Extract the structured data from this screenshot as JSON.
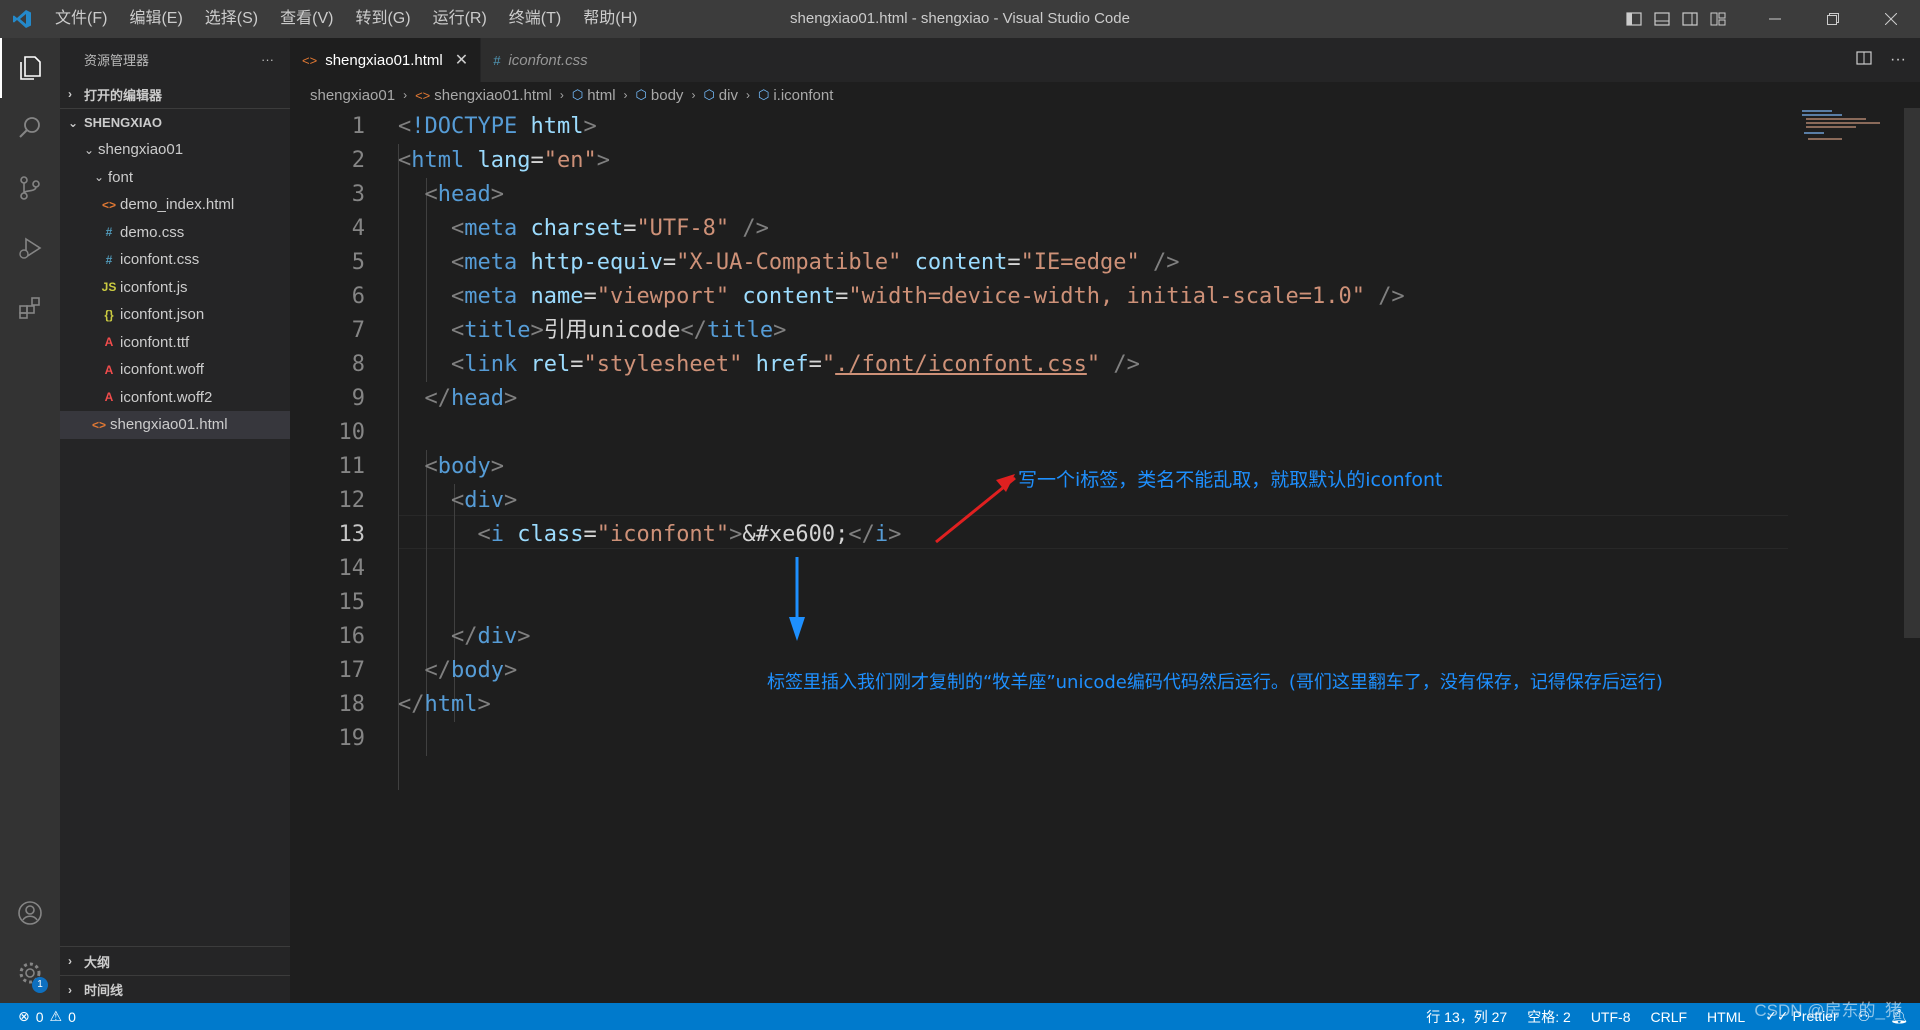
{
  "titlebar": {
    "menu": [
      "文件(F)",
      "编辑(E)",
      "选择(S)",
      "查看(V)",
      "转到(G)",
      "运行(R)",
      "终端(T)",
      "帮助(H)"
    ],
    "title": "shengxiao01.html - shengxiao - Visual Studio Code"
  },
  "sidebar": {
    "header": "资源管理器",
    "more": "···",
    "open_editors": "打开的编辑器",
    "workspace": "SHENGXIAO",
    "folder": "shengxiao01",
    "subfolder": "font",
    "files": [
      {
        "icon": "<>",
        "name": "demo_index.html",
        "color": "#e37933"
      },
      {
        "icon": "#",
        "name": "demo.css",
        "color": "#519aba"
      },
      {
        "icon": "#",
        "name": "iconfont.css",
        "color": "#519aba"
      },
      {
        "icon": "JS",
        "name": "iconfont.js",
        "color": "#cbcb41"
      },
      {
        "icon": "{}",
        "name": "iconfont.json",
        "color": "#cbcb41"
      },
      {
        "icon": "A",
        "name": "iconfont.ttf",
        "color": "#f14c4c"
      },
      {
        "icon": "A",
        "name": "iconfont.woff",
        "color": "#f14c4c"
      },
      {
        "icon": "A",
        "name": "iconfont.woff2",
        "color": "#f14c4c"
      }
    ],
    "root_file": {
      "icon": "<>",
      "name": "shengxiao01.html",
      "color": "#e37933"
    },
    "outline": "大纲",
    "timeline": "时间线"
  },
  "tabs": [
    {
      "icon": "<>",
      "label": "shengxiao01.html",
      "close": "✕"
    },
    {
      "icon": "#",
      "label": "iconfont.css"
    }
  ],
  "breadcrumb": [
    "shengxiao01",
    "shengxiao01.html",
    "html",
    "body",
    "div",
    "i.iconfont"
  ],
  "code": {
    "line_numbers": [
      "1",
      "2",
      "3",
      "4",
      "5",
      "6",
      "7",
      "8",
      "9",
      "10",
      "11",
      "12",
      "13",
      "14",
      "15",
      "16",
      "17",
      "18",
      "19"
    ],
    "current_line": 13
  },
  "annotations": {
    "top": "写一个i标签，类名不能乱取，就取默认的iconfont",
    "bottom": "标签里插入我们刚才复制的“牧羊座”unicode编码代码然后运行。(哥们这里翻车了，没有保存，记得保存后运行)"
  },
  "statusbar": {
    "errors": "0",
    "warnings": "0",
    "position": "行 13，列 27",
    "spaces": "空格: 2",
    "encoding": "UTF-8",
    "eol": "CRLF",
    "language": "HTML",
    "formatter": "Prettier"
  },
  "watermark": "CSDN @房东的_猪",
  "colors": {
    "accent": "#007acc",
    "annotation": "#1e90ff",
    "arrow_red": "#e02020"
  }
}
